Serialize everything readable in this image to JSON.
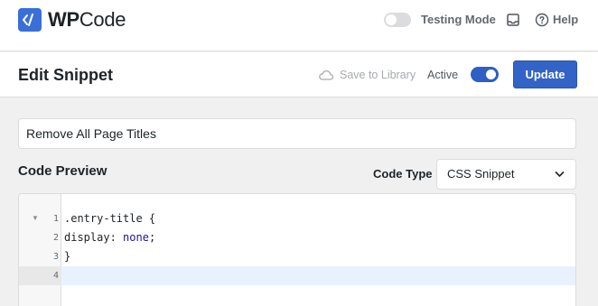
{
  "brand": {
    "name_bold": "WP",
    "name_regular": "Code",
    "accent": "#3a6fd8"
  },
  "topbar": {
    "testing_mode_label": "Testing Mode",
    "testing_mode_on": false,
    "inbox_icon": "inbox-icon",
    "help_label": "Help"
  },
  "header": {
    "title": "Edit Snippet",
    "save_to_library_label": "Save to Library",
    "active_label": "Active",
    "active_on": true,
    "update_label": "Update",
    "update_color": "#3363c7"
  },
  "snippet": {
    "title_value": "Remove All Page Titles",
    "code_preview_label": "Code Preview",
    "code_type_label": "Code Type",
    "code_type_value": "CSS Snippet"
  },
  "editor": {
    "line_numbers": [
      "1",
      "2",
      "3",
      "4"
    ],
    "lines": {
      "l1": ".entry-title {",
      "l2_prop": "display: ",
      "l2_val": "none",
      "l2_end": ";",
      "l3": "}",
      "l4": ""
    },
    "active_line": 4
  }
}
